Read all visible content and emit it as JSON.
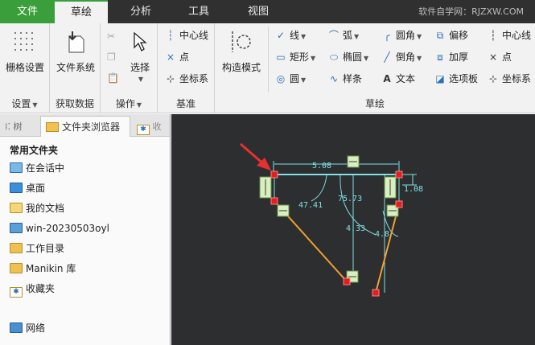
{
  "menubar": {
    "tabs": [
      "文件",
      "草绘",
      "分析",
      "工具",
      "视图"
    ],
    "watermark": "软件自学网：RJZXW.COM"
  },
  "ribbon": {
    "settings": {
      "grid_label": "栅格设置",
      "group_label": "设置"
    },
    "get_data": {
      "file_system_label": "文件系统",
      "group_label": "获取数据"
    },
    "operations": {
      "select_label": "选择",
      "group_label": "操作"
    },
    "datum": {
      "centerline": "中心线",
      "point": "点",
      "coord_sys": "坐标系",
      "group_label": "基准"
    },
    "sketch": {
      "construction_mode": "构造模式",
      "line": "线",
      "rectangle": "矩形",
      "circle": "圆",
      "arc": "弧",
      "ellipse": "椭圆",
      "spline": "样条",
      "fillet": "圆角",
      "chamfer": "倒角",
      "text": "文本",
      "offset": "偏移",
      "thicken": "加厚",
      "palette": "选项板",
      "centerline": "中心线",
      "point": "点",
      "coord_sys": "坐标系",
      "group_label": "草绘"
    }
  },
  "left_panel": {
    "tabs": [
      "",
      "文件夹浏览器",
      ""
    ],
    "folder_title": "常用文件夹",
    "items": [
      {
        "label": "在会话中",
        "icon": "monitor-icon"
      },
      {
        "label": "桌面",
        "icon": "desktop-icon"
      },
      {
        "label": "我的文档",
        "icon": "documents-icon"
      },
      {
        "label": "win-20230503oyl",
        "icon": "computer-icon"
      },
      {
        "label": "工作目录",
        "icon": "folder-icon"
      },
      {
        "label": "Manikin 库",
        "icon": "folder-icon"
      },
      {
        "label": "收藏夹",
        "icon": "favorites-icon"
      }
    ],
    "network": "网络"
  },
  "canvas": {
    "dimensions": [
      "5.08",
      "47.41",
      "75.73",
      "4.33",
      "4.8",
      "1.08"
    ],
    "colors": {
      "background": "#2c2e30",
      "dimension": "#7fe0e6",
      "line_orange": "#f0a030",
      "constraint_box": "#d8f0c0",
      "vertex_red": "#e02020",
      "arrow_red": "#e83030"
    }
  }
}
